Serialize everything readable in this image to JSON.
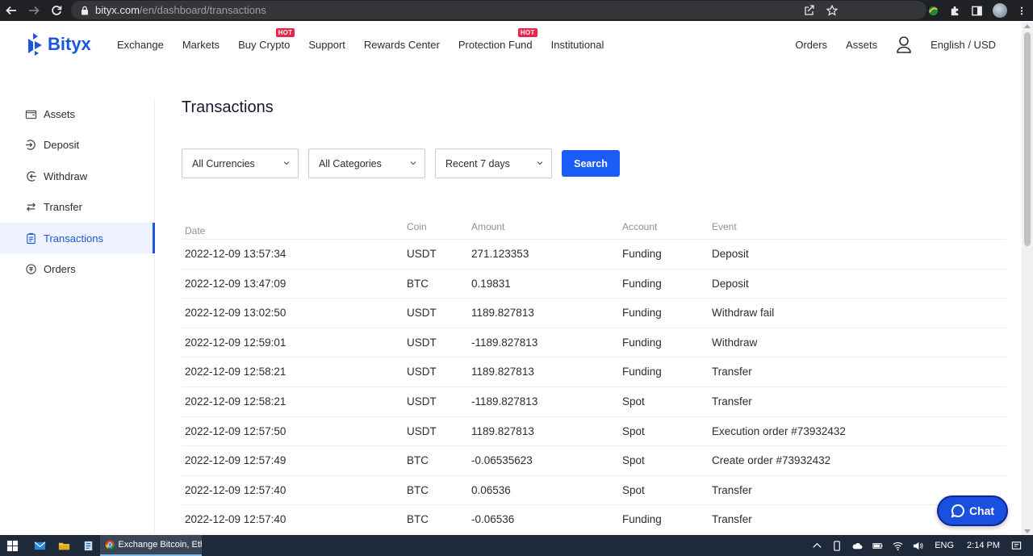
{
  "browser": {
    "url_host": "bityx.com",
    "url_path": "/en/dashboard/transactions"
  },
  "header": {
    "logo_text": "Bityx",
    "nav": [
      {
        "label": "Exchange",
        "hot": false
      },
      {
        "label": "Markets",
        "hot": false
      },
      {
        "label": "Buy Crypto",
        "hot": true
      },
      {
        "label": "Support",
        "hot": false
      },
      {
        "label": "Rewards Center",
        "hot": false
      },
      {
        "label": "Protection Fund",
        "hot": true
      },
      {
        "label": "Institutional",
        "hot": false
      }
    ],
    "hot_label": "HOT",
    "orders": "Orders",
    "assets": "Assets",
    "language": "English / USD"
  },
  "sidebar": {
    "items": [
      {
        "label": "Assets",
        "icon": "wallet-icon",
        "active": false
      },
      {
        "label": "Deposit",
        "icon": "deposit-icon",
        "active": false
      },
      {
        "label": "Withdraw",
        "icon": "withdraw-icon",
        "active": false
      },
      {
        "label": "Transfer",
        "icon": "transfer-icon",
        "active": false
      },
      {
        "label": "Transactions",
        "icon": "clipboard-icon",
        "active": true
      },
      {
        "label": "Orders",
        "icon": "orders-icon",
        "active": false
      }
    ]
  },
  "main": {
    "title": "Transactions",
    "filters": {
      "currency": "All Currencies",
      "category": "All Categories",
      "period": "Recent 7 days",
      "search_label": "Search"
    },
    "table": {
      "headers": {
        "date": "Date",
        "coin": "Coin",
        "amount": "Amount",
        "account": "Account",
        "event": "Event"
      },
      "rows": [
        {
          "date": "2022-12-09 13:57:34",
          "coin": "USDT",
          "amount": "271.123353",
          "account": "Funding",
          "event": "Deposit"
        },
        {
          "date": "2022-12-09 13:47:09",
          "coin": "BTC",
          "amount": "0.19831",
          "account": "Funding",
          "event": "Deposit"
        },
        {
          "date": "2022-12-09 13:02:50",
          "coin": "USDT",
          "amount": "1189.827813",
          "account": "Funding",
          "event": "Withdraw fail"
        },
        {
          "date": "2022-12-09 12:59:01",
          "coin": "USDT",
          "amount": "-1189.827813",
          "account": "Funding",
          "event": "Withdraw"
        },
        {
          "date": "2022-12-09 12:58:21",
          "coin": "USDT",
          "amount": "1189.827813",
          "account": "Funding",
          "event": "Transfer"
        },
        {
          "date": "2022-12-09 12:58:21",
          "coin": "USDT",
          "amount": "-1189.827813",
          "account": "Spot",
          "event": "Transfer"
        },
        {
          "date": "2022-12-09 12:57:50",
          "coin": "USDT",
          "amount": "1189.827813",
          "account": "Spot",
          "event": "Execution order #73932432"
        },
        {
          "date": "2022-12-09 12:57:49",
          "coin": "BTC",
          "amount": "-0.06535623",
          "account": "Spot",
          "event": "Create order #73932432"
        },
        {
          "date": "2022-12-09 12:57:40",
          "coin": "BTC",
          "amount": "0.06536",
          "account": "Spot",
          "event": "Transfer"
        },
        {
          "date": "2022-12-09 12:57:40",
          "coin": "BTC",
          "amount": "-0.06536",
          "account": "Funding",
          "event": "Transfer"
        }
      ]
    }
  },
  "chat": {
    "label": "Chat"
  },
  "taskbar": {
    "app_label": "Exchange Bitcoin, Eth...",
    "lang": "ENG",
    "time": "2:14 PM"
  },
  "colors": {
    "accent": "#1a56db",
    "hot": "#e8254a",
    "button": "#1a5cf5"
  }
}
